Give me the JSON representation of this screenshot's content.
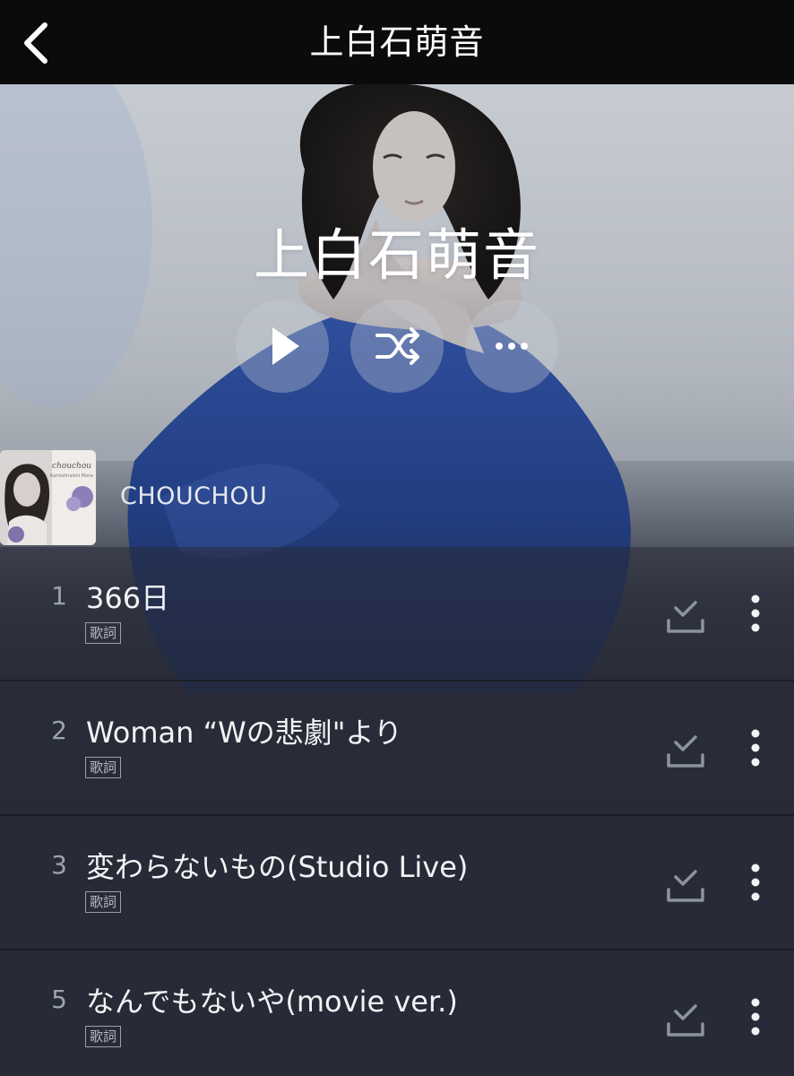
{
  "navbar": {
    "title": "上白石萌音",
    "back_icon": "chevron-left-icon"
  },
  "hero": {
    "artist_name": "上白石萌音",
    "actions": [
      {
        "name": "play-button",
        "icon": "play-icon"
      },
      {
        "name": "shuffle-button",
        "icon": "shuffle-icon"
      },
      {
        "name": "more-button",
        "icon": "more-horizontal-icon"
      }
    ]
  },
  "album": {
    "name": "CHOUCHOU",
    "cover_text": "chouchou",
    "cover_subtext": "Kamishiraishi Mone"
  },
  "tracks": [
    {
      "number": "1",
      "title": "366日",
      "lyrics_label": "歌詞"
    },
    {
      "number": "2",
      "title": "Woman “Wの悲劇\"より",
      "lyrics_label": "歌詞"
    },
    {
      "number": "3",
      "title": "変わらないもの(Studio Live)",
      "lyrics_label": "歌詞"
    },
    {
      "number": "5",
      "title": "なんでもないや(movie ver.)",
      "lyrics_label": "歌詞"
    }
  ],
  "colors": {
    "navbar_bg": "#0b0b0c",
    "dress_blue": "#2c4a93",
    "list_bg": "#262a35",
    "text_primary": "#f2f3f5",
    "text_secondary": "#9ea4ae"
  }
}
